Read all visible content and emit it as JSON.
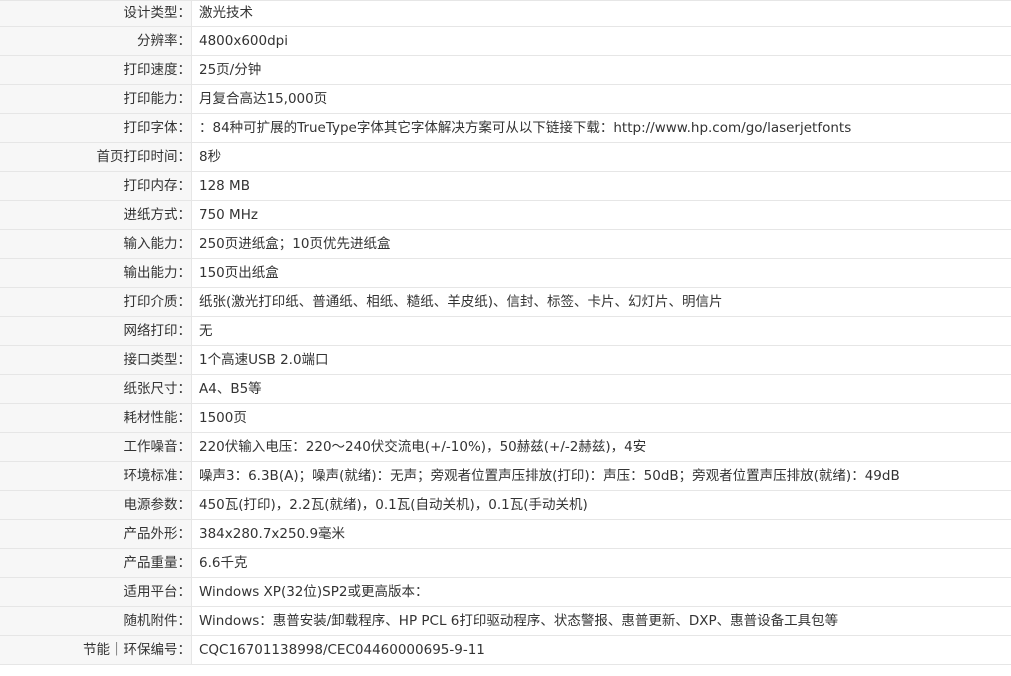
{
  "specs": {
    "rows": [
      {
        "label": "设计类型：",
        "value": "激光技术"
      },
      {
        "label": "分辨率：",
        "value": "4800x600dpi"
      },
      {
        "label": "打印速度：",
        "value": "25页/分钟"
      },
      {
        "label": "打印能力：",
        "value": "月复合高达15,000页"
      },
      {
        "label": "打印字体：",
        "value": "：84种可扩展的TrueType字体其它字体解决方案可从以下链接下载：http://www.hp.com/go/laserjetfonts"
      },
      {
        "label": "首页打印时间：",
        "value": "8秒"
      },
      {
        "label": "打印内存：",
        "value": "128 MB"
      },
      {
        "label": "进纸方式：",
        "value": "750 MHz"
      },
      {
        "label": "输入能力：",
        "value": "250页进纸盒；10页优先进纸盒"
      },
      {
        "label": "输出能力：",
        "value": "150页出纸盒"
      },
      {
        "label": "打印介质：",
        "value": "纸张(激光打印纸、普通纸、相纸、糙纸、羊皮纸)、信封、标签、卡片、幻灯片、明信片"
      },
      {
        "label": "网络打印：",
        "value": "无"
      },
      {
        "label": "接口类型：",
        "value": "1个高速USB 2.0端口"
      },
      {
        "label": "纸张尺寸：",
        "value": "A4、B5等"
      },
      {
        "label": "耗材性能：",
        "value": "1500页"
      },
      {
        "label": "工作噪音：",
        "value": "220伏输入电压：220～240伏交流电(+/-10%)，50赫兹(+/-2赫兹)，4安"
      },
      {
        "label": "环境标准：",
        "value": "噪声3：6.3B(A)；噪声(就绪)：无声；旁观者位置声压排放(打印)：声压：50dB；旁观者位置声压排放(就绪)：49dB"
      },
      {
        "label": "电源参数：",
        "value": "450瓦(打印)，2.2瓦(就绪)，0.1瓦(自动关机)，0.1瓦(手动关机)"
      },
      {
        "label": "产品外形：",
        "value": "384x280.7x250.9毫米"
      },
      {
        "label": "产品重量：",
        "value": "6.6千克"
      },
      {
        "label": "适用平台：",
        "value": "Windows XP(32位)SP2或更高版本："
      },
      {
        "label": "随机附件：",
        "value": "Windows：惠普安装/卸载程序、HP PCL 6打印驱动程序、状态警报、惠普更新、DXP、惠普设备工具包等"
      },
      {
        "label": "节能｜环保编号：",
        "value": "CQC16701138998/CEC04460000695-9-11"
      }
    ]
  }
}
